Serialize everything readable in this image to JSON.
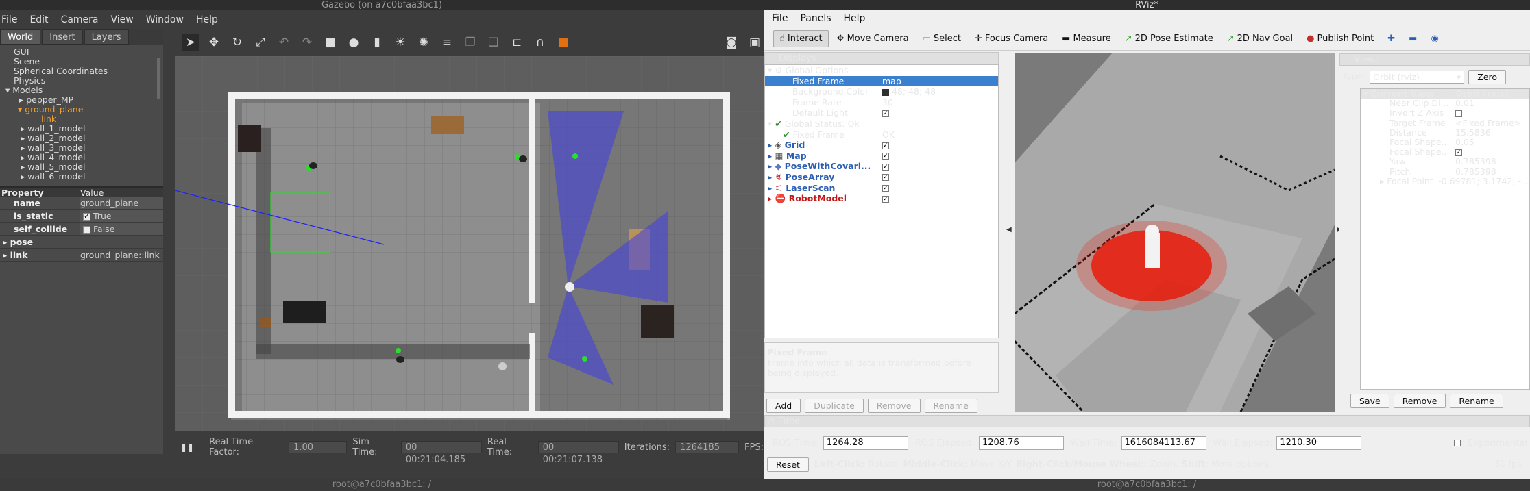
{
  "gazebo": {
    "title": "Gazebo (on a7c0bfaa3bc1)",
    "menu": [
      "File",
      "Edit",
      "Camera",
      "View",
      "Window",
      "Help"
    ],
    "tabs": [
      "World",
      "Insert",
      "Layers"
    ],
    "tree": [
      "GUI",
      "Scene",
      "Spherical Coordinates",
      "Physics",
      "Models",
      "pepper_MP",
      "ground_plane",
      "link",
      "wall_1_model",
      "wall_2_model",
      "wall_3_model",
      "wall_4_model",
      "wall_5_model",
      "wall_6_model"
    ],
    "prop_header": [
      "Property",
      "Value"
    ],
    "props": [
      {
        "k": "name",
        "v": "ground_plane"
      },
      {
        "k": "is_static",
        "v": "True",
        "check": "✓"
      },
      {
        "k": "self_collide",
        "v": "False",
        "check": ""
      },
      {
        "k": "pose",
        "v": ""
      },
      {
        "k": "link",
        "v": "ground_plane::link"
      }
    ],
    "bottom": {
      "pause": "❚❚",
      "rtf_label": "Real Time Factor:",
      "rtf": "1.00",
      "sim_label": "Sim Time:",
      "sim": "00 00:21:04.185",
      "real_label": "Real Time:",
      "real": "00 00:21:07.138",
      "iter_label": "Iterations:",
      "iter": "1264185",
      "fps_label": "FPS:"
    },
    "terminal": "root@a7c0bfaa3bc1: /"
  },
  "rviz": {
    "title": "RViz*",
    "menu": [
      "File",
      "Panels",
      "Help"
    ],
    "tools": [
      "Interact",
      "Move Camera",
      "Select",
      "Focus Camera",
      "Measure",
      "2D Pose Estimate",
      "2D Nav Goal",
      "Publish Point"
    ],
    "displays_title": "Displays",
    "rows": [
      {
        "a": "Global Options",
        "b": ""
      },
      {
        "a": "Fixed Frame",
        "b": "map"
      },
      {
        "a": "Background Color",
        "b": "48; 48; 48"
      },
      {
        "a": "Frame Rate",
        "b": "30"
      },
      {
        "a": "Default Light",
        "b": "✓"
      },
      {
        "a": "Global Status: Ok",
        "b": ""
      },
      {
        "a": "Fixed Frame",
        "b": "OK"
      },
      {
        "a": "Grid",
        "b": "✓"
      },
      {
        "a": "Map",
        "b": "✓"
      },
      {
        "a": "PoseWithCovari...",
        "b": "✓"
      },
      {
        "a": "PoseArray",
        "b": "✓"
      },
      {
        "a": "LaserScan",
        "b": "✓"
      },
      {
        "a": "RobotModel",
        "b": "✓"
      }
    ],
    "desc_title": "Fixed Frame",
    "desc_text": "Frame into which all data is transformed before being displayed.",
    "disp_buttons": [
      "Add",
      "Duplicate",
      "Remove",
      "Rename"
    ],
    "views_title": "Views",
    "type_label": "Type:",
    "type_value": "Orbit (rviz)",
    "zero": "Zero",
    "views": [
      {
        "a": "Current View",
        "b": "Orbit (rviz)"
      },
      {
        "a": "Near Clip Di...",
        "b": "0.01"
      },
      {
        "a": "Invert Z Axis",
        "b": ""
      },
      {
        "a": "Target Frame",
        "b": "<Fixed Frame>"
      },
      {
        "a": "Distance",
        "b": "15.5836"
      },
      {
        "a": "Focal Shape...",
        "b": "0.05"
      },
      {
        "a": "Focal Shape...",
        "b": "✓"
      },
      {
        "a": "Yaw",
        "b": "0.785398"
      },
      {
        "a": "Pitch",
        "b": "0.785398"
      },
      {
        "a": "Focal Point",
        "b": "-0.69781; 3.1742; -..."
      }
    ],
    "views_buttons": [
      "Save",
      "Remove",
      "Rename"
    ],
    "time_title": "Time",
    "ros_time_label": "ROS Time:",
    "ros_time": "1264.28",
    "ros_elapsed_label": "ROS Elapsed:",
    "ros_elapsed": "1208.76",
    "wall_time_label": "Wall Time:",
    "wall_time": "1616084113.67",
    "wall_elapsed_label": "Wall Elapsed:",
    "wall_elapsed": "1210.30",
    "experimental": "Experimental",
    "reset": "Reset",
    "hint_parts": [
      "Left-Click:",
      " Rotate. ",
      "Middle-Click:",
      " Move X/Y. ",
      "Right-Click/Mouse Wheel:",
      ": Zoom. ",
      "Shift",
      ": More options."
    ],
    "fps": "31 fps",
    "terminal": "root@a7c0bfaa3bc1: /"
  }
}
